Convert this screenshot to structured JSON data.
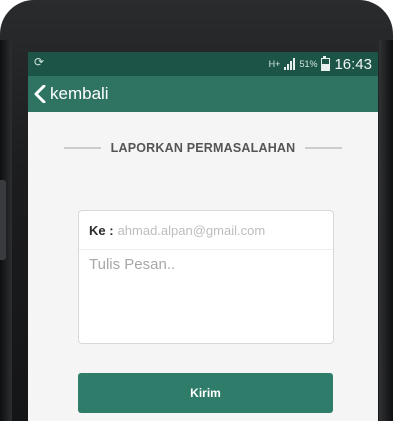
{
  "status_bar": {
    "network": "H+",
    "battery_percent": "51%",
    "time": "16:43",
    "battery_level": 0.51
  },
  "app_bar": {
    "back_label": "kembali"
  },
  "page": {
    "section_title": "LAPORKAN PERMASALAHAN"
  },
  "form": {
    "to_label": "Ke :",
    "to_value": "ahmad.alpan@gmail.com",
    "message_placeholder": "Tulis Pesan..",
    "submit_label": "Kirim"
  },
  "colors": {
    "status_bar": "#1c5548",
    "app_bar": "#2f7362",
    "button": "#2f7c6a"
  }
}
